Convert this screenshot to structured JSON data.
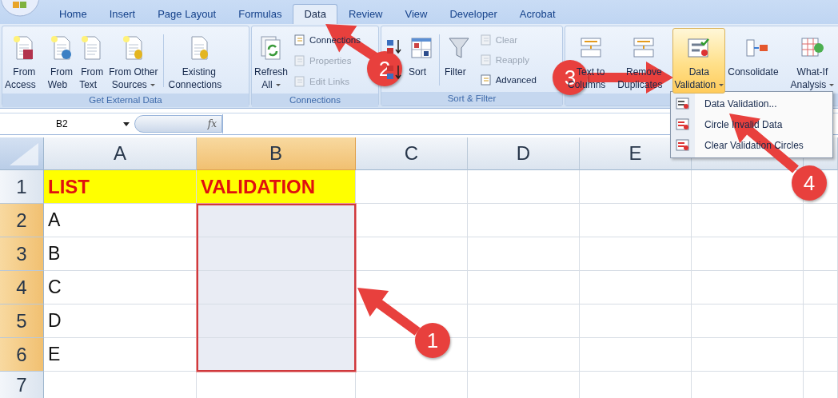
{
  "tabs": [
    {
      "label": "Home",
      "selected": false
    },
    {
      "label": "Insert",
      "selected": false
    },
    {
      "label": "Page Layout",
      "selected": false
    },
    {
      "label": "Formulas",
      "selected": false
    },
    {
      "label": "Data",
      "selected": true
    },
    {
      "label": "Review",
      "selected": false
    },
    {
      "label": "View",
      "selected": false
    },
    {
      "label": "Developer",
      "selected": false
    },
    {
      "label": "Acrobat",
      "selected": false
    }
  ],
  "ribbon_groups": [
    {
      "label": "Get External Data",
      "items": [
        {
          "kind": "large",
          "lines": [
            "From",
            "Access"
          ],
          "dropdown": false,
          "pressed": false
        },
        {
          "kind": "large",
          "lines": [
            "From",
            "Web"
          ],
          "dropdown": false,
          "pressed": false
        },
        {
          "kind": "large",
          "lines": [
            "From",
            "Text"
          ],
          "dropdown": false,
          "pressed": false
        },
        {
          "kind": "large",
          "lines": [
            "From Other",
            "Sources"
          ],
          "dropdown": true,
          "pressed": false
        },
        {
          "kind": "separator"
        },
        {
          "kind": "large",
          "lines": [
            "Existing",
            "Connections"
          ],
          "dropdown": false,
          "pressed": false
        }
      ]
    },
    {
      "label": "Connections",
      "items": [
        {
          "kind": "large",
          "lines": [
            "Refresh",
            "All"
          ],
          "dropdown": true,
          "pressed": false
        },
        {
          "kind": "stack",
          "buttons": [
            {
              "label": "Connections",
              "disabled": false
            },
            {
              "label": "Properties",
              "disabled": true
            },
            {
              "label": "Edit Links",
              "disabled": true
            }
          ]
        }
      ]
    },
    {
      "label": "Sort & Filter",
      "items": [
        {
          "kind": "sort-icons"
        },
        {
          "kind": "large",
          "lines": [
            "Sort"
          ],
          "dropdown": false,
          "pressed": false
        },
        {
          "kind": "separator"
        },
        {
          "kind": "large",
          "lines": [
            "Filter"
          ],
          "dropdown": false,
          "pressed": false
        },
        {
          "kind": "stack",
          "buttons": [
            {
              "label": "Clear",
              "disabled": true
            },
            {
              "label": "Reapply",
              "disabled": true
            },
            {
              "label": "Advanced",
              "disabled": false
            }
          ]
        }
      ]
    },
    {
      "items": [
        {
          "kind": "large",
          "lines": [
            "Text to",
            "Columns"
          ],
          "dropdown": false,
          "pressed": false
        },
        {
          "kind": "large",
          "lines": [
            "Remove",
            "Duplicates"
          ],
          "dropdown": false,
          "pressed": false
        },
        {
          "kind": "large",
          "lines": [
            "Data",
            "Validation"
          ],
          "dropdown": true,
          "pressed": true
        },
        {
          "kind": "large",
          "lines": [
            "Consolidate"
          ],
          "dropdown": false,
          "pressed": false
        },
        {
          "kind": "large",
          "lines": [
            "What-If",
            "Analysis"
          ],
          "dropdown": true,
          "pressed": false
        }
      ]
    }
  ],
  "formula_bar": {
    "name_box": "B2",
    "function_label": "fx"
  },
  "columns": [
    {
      "label": "A",
      "selected": false
    },
    {
      "label": "B",
      "selected": true
    },
    {
      "label": "C",
      "selected": false
    },
    {
      "label": "D",
      "selected": false
    },
    {
      "label": "E",
      "selected": false
    }
  ],
  "rows": [
    {
      "header": "1",
      "selected": false,
      "cells": [
        {
          "text": "LIST",
          "kind": "heading",
          "selected": false
        },
        {
          "text": "VALIDATION",
          "kind": "heading",
          "selected": false
        }
      ]
    },
    {
      "header": "2",
      "selected": true,
      "cells": [
        {
          "text": "A",
          "kind": "value",
          "selected": false
        },
        {
          "text": "",
          "kind": "value",
          "selected": true
        }
      ]
    },
    {
      "header": "3",
      "selected": true,
      "cells": [
        {
          "text": "B",
          "kind": "value",
          "selected": false
        },
        {
          "text": "",
          "kind": "value",
          "selected": true
        }
      ]
    },
    {
      "header": "4",
      "selected": true,
      "cells": [
        {
          "text": "C",
          "kind": "value",
          "selected": false
        },
        {
          "text": "",
          "kind": "value",
          "selected": true
        }
      ]
    },
    {
      "header": "5",
      "selected": true,
      "cells": [
        {
          "text": "D",
          "kind": "value",
          "selected": false
        },
        {
          "text": "",
          "kind": "value",
          "selected": true
        }
      ]
    },
    {
      "header": "6",
      "selected": true,
      "cells": [
        {
          "text": "E",
          "kind": "value",
          "selected": false
        },
        {
          "text": "",
          "kind": "value",
          "selected": true
        }
      ]
    },
    {
      "header": "7",
      "selected": false,
      "cells": []
    }
  ],
  "menu": [
    {
      "label": "Data Validation..."
    },
    {
      "label": "Circle Invalid Data"
    },
    {
      "label": "Clear Validation Circles"
    }
  ],
  "annotations": [
    {
      "number": "1"
    },
    {
      "number": "2"
    },
    {
      "number": "3"
    },
    {
      "number": "4"
    }
  ]
}
